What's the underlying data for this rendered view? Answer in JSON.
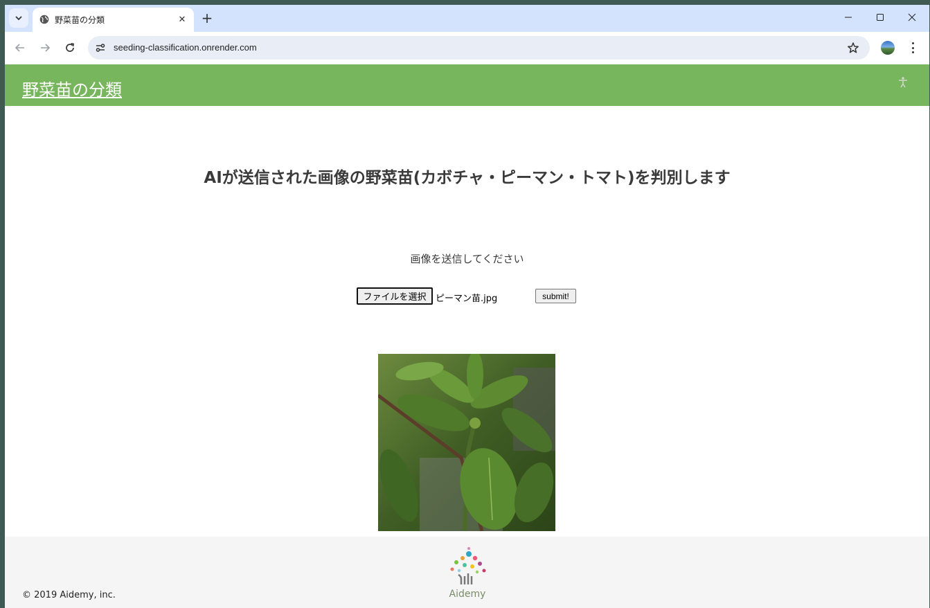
{
  "browser": {
    "tab_title": "野菜苗の分類",
    "url": "seeding-classification.onrender.com"
  },
  "header": {
    "title": "野菜苗の分類"
  },
  "main": {
    "heading": "AIが送信された画像の野菜苗(カボチャ・ピーマン・トマト)を判別します",
    "instruction": "画像を送信してください",
    "file_button_label": "ファイルを選択",
    "file_name": "ピーマン苗.jpg",
    "submit_label": "submit!"
  },
  "footer": {
    "copyright": "© 2019 Aidemy, inc.",
    "logo_text": "Aidemy"
  },
  "colors": {
    "header_bg": "#77b65c",
    "tabstrip_bg": "#d3e3fd",
    "footer_bg": "#f5f5f5"
  }
}
